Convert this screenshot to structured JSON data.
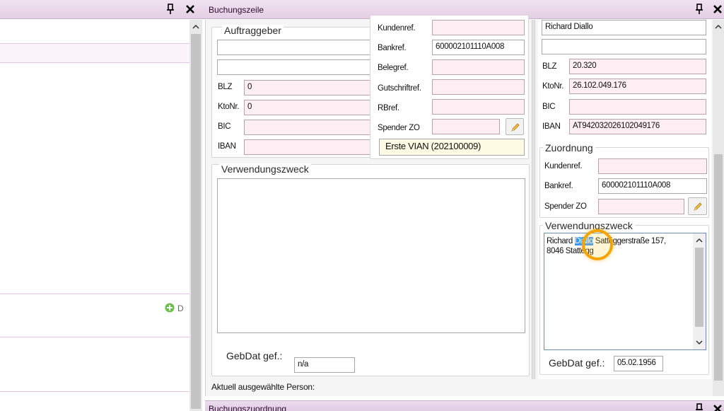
{
  "left_panel": {
    "pin_icon_glyph": "↕",
    "close_glyph": "✕",
    "scroll_up_glyph": "⌃",
    "add_button_label": "D"
  },
  "main": {
    "title": "Buchungszeile",
    "pin_icon_glyph": "↕",
    "close_glyph": "✕",
    "auftraggeber": {
      "legend": "Auftraggeber",
      "name1": "",
      "name2": "",
      "blz_label": "BLZ",
      "blz_value": "0",
      "ktonr_label": "KtoNr.",
      "ktonr_value": "0",
      "bic_label": "BIC",
      "bic_value": "",
      "iban_label": "IBAN",
      "iban_value": ""
    },
    "refs": {
      "kundenref_label": "Kundenref.",
      "kundenref_value": "",
      "bankref_label": "Bankref.",
      "bankref_value": "600002101110A008",
      "belegref_label": "Belegref.",
      "belegref_value": "",
      "gutschriftref_label": "Gutschriftref.",
      "gutschriftref_value": "",
      "rbref_label": "RBref.",
      "rbref_value": "",
      "spender_zo_label": "Spender ZO",
      "spender_zo_value": "",
      "vian_value": "Erste VIAN (202100009)"
    },
    "verwendungszweck_left": {
      "legend": "Verwendungszweck",
      "text": ""
    },
    "gebdat_left": {
      "label": "GebDat gef.:",
      "value": "n/a"
    },
    "right": {
      "name": "Richard Diallo",
      "line2": "",
      "blz_label": "BLZ",
      "blz_value": "20.320",
      "ktonr_label": "KtoNr.",
      "ktonr_value": "26.102.049.176",
      "bic_label": "BIC",
      "bic_value": "",
      "iban_label": "IBAN",
      "iban_value": "AT942032026102049176",
      "zuordnung": {
        "legend": "Zuordnung",
        "kundenref_label": "Kundenref.",
        "kundenref_value": "",
        "bankref_label": "Bankref.",
        "bankref_value": "600002101110A008",
        "spender_zo_label": "Spender ZO",
        "spender_zo_value": ""
      },
      "verwendungszweck": {
        "legend": "Verwendungszweck",
        "text_before": "Richard ",
        "text_selected": "Diallo",
        "text_after": " Sattéggerstraße 157,",
        "text_line2": "8046 Stattegg"
      },
      "gebdat": {
        "label": "GebDat gef.:",
        "value": "05.02.1956"
      }
    },
    "status_label": "Aktuell ausgewählte Person:",
    "bottom_panel_title": "Buchungszuordnung"
  },
  "colors": {
    "titlebar": "#e8d4e8",
    "input_pink": "#fdeef4",
    "input_yellow": "#fefbe4",
    "selection": "#3399ff",
    "highlight": "#f4a300"
  }
}
